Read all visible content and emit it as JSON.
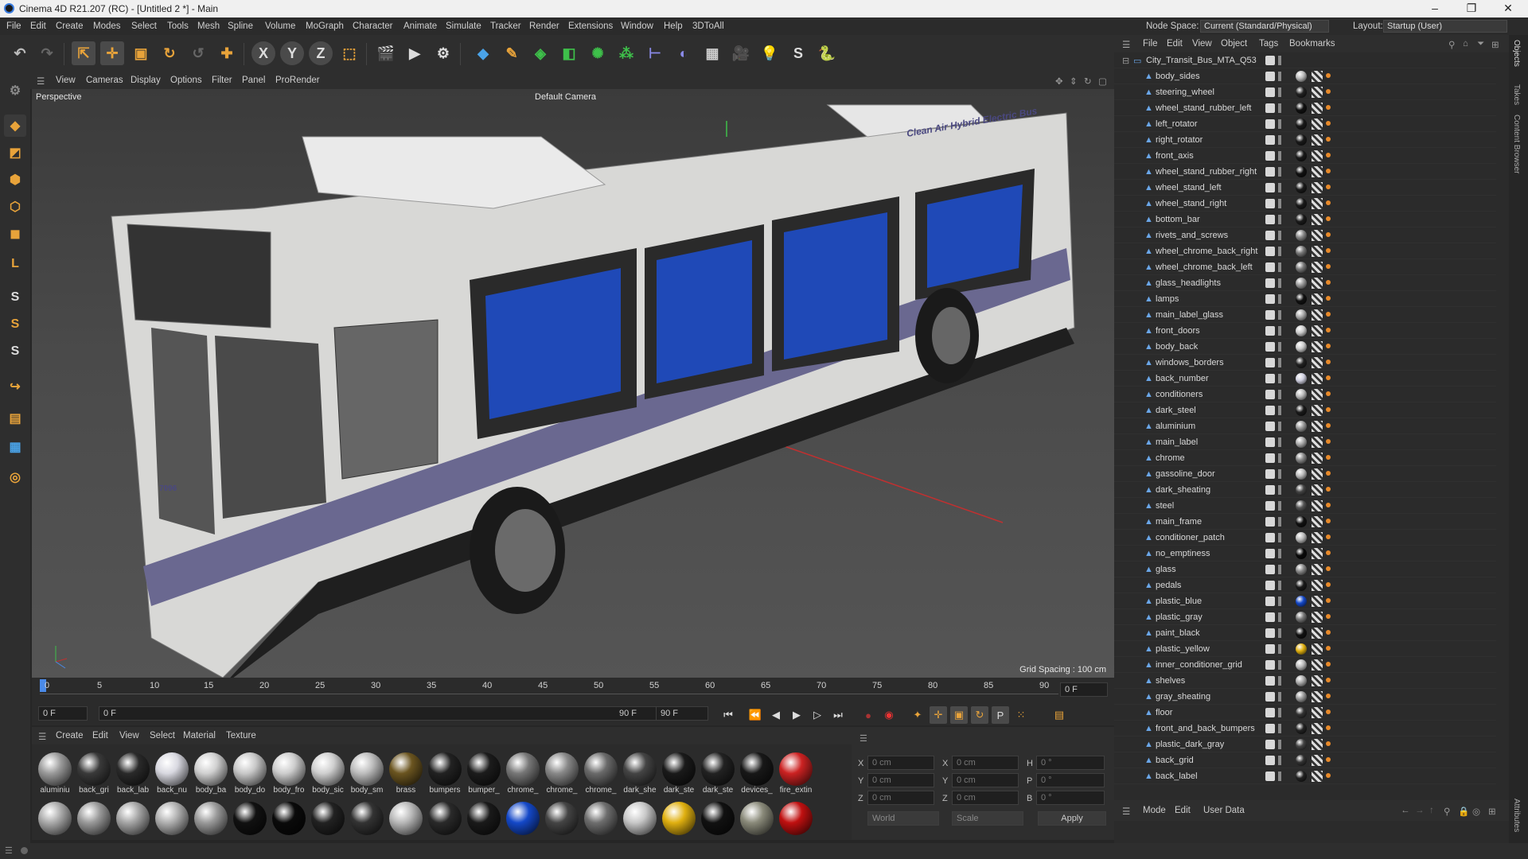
{
  "window": {
    "title": "Cinema 4D R21.207 (RC) - [Untitled 2 *] - Main",
    "controls": [
      "–",
      "❐",
      "✕"
    ]
  },
  "menu": {
    "items": [
      "File",
      "Edit",
      "Create",
      "Modes",
      "Select",
      "Tools",
      "Mesh",
      "Spline",
      "Volume",
      "MoGraph",
      "Character",
      "Animate",
      "Simulate",
      "Tracker",
      "Render",
      "Extensions",
      "Window",
      "Help",
      "3DToAll"
    ],
    "node_space_label": "Node Space:",
    "node_space_value": "Current (Standard/Physical)",
    "layout_label": "Layout:",
    "layout_value": "Startup (User)"
  },
  "toolbar": {
    "icons": [
      "undo-icon",
      "redo-icon",
      "select-icon",
      "move-icon",
      "scale-icon",
      "rotate-icon",
      "recent-tool-icon",
      "coordinate-axis-icon",
      "x-axis-icon",
      "y-axis-icon",
      "z-axis-icon",
      "world-coordinates-icon",
      "render-view-icon",
      "render-picture-viewer-icon",
      "render-settings-icon",
      "cube-icon",
      "pen-icon",
      "subdivision-icon",
      "extrude-icon",
      "cloner-icon",
      "mograph-icon",
      "symmetry-icon",
      "deformer-icon",
      "floor-icon",
      "camera-icon",
      "light-icon",
      "script-icon",
      "python-icon"
    ],
    "axis_labels": [
      "X",
      "Y",
      "Z"
    ]
  },
  "viewport": {
    "menu": [
      "View",
      "Cameras",
      "Display",
      "Options",
      "Filter",
      "Panel",
      "ProRender"
    ],
    "label": "Perspective",
    "camera": "Default Camera",
    "grid_spacing": "Grid Spacing : 100 cm",
    "bus_banner": "Clean Air Hybrid Electric Bus",
    "bus_number": "7096"
  },
  "timeline": {
    "ticks": [
      "0",
      "5",
      "10",
      "15",
      "20",
      "25",
      "30",
      "35",
      "40",
      "45",
      "50",
      "55",
      "60",
      "65",
      "70",
      "75",
      "80",
      "85",
      "90"
    ],
    "current_frame": "0 F"
  },
  "transport": {
    "start": "0 F",
    "range_start": "0 F",
    "range_end": "90 F",
    "end": "90 F"
  },
  "material_manager": {
    "menu": [
      "Create",
      "Edit",
      "View",
      "Select",
      "Material",
      "Texture"
    ],
    "row1": [
      {
        "name": "aluminiu",
        "color": "#9a9a9a"
      },
      {
        "name": "back_gri",
        "color": "#3a3a3a"
      },
      {
        "name": "back_lab",
        "color": "#2a2a2a"
      },
      {
        "name": "back_nu",
        "color": "#d8d8e0"
      },
      {
        "name": "body_ba",
        "color": "#d0d0d0"
      },
      {
        "name": "body_do",
        "color": "#c8c8c8"
      },
      {
        "name": "body_fro",
        "color": "#cdcdcd"
      },
      {
        "name": "body_sic",
        "color": "#cfcfcf"
      },
      {
        "name": "body_sm",
        "color": "#bdbdbd"
      },
      {
        "name": "brass",
        "color": "#6b5520"
      },
      {
        "name": "bumpers",
        "color": "#222"
      },
      {
        "name": "bumper_",
        "color": "#1c1c1c"
      },
      {
        "name": "chrome_",
        "color": "#777"
      },
      {
        "name": "chrome_",
        "color": "#888"
      },
      {
        "name": "chrome_",
        "color": "#6a6a6a"
      },
      {
        "name": "dark_she",
        "color": "#444"
      },
      {
        "name": "dark_ste",
        "color": "#1a1a1a"
      },
      {
        "name": "dark_ste",
        "color": "#222"
      },
      {
        "name": "devices_",
        "color": "#181818"
      },
      {
        "name": "fire_extin",
        "color": "#c22"
      }
    ],
    "row2": [
      "#aaa",
      "#999",
      "#a5a5a5",
      "#b0b0b0",
      "#9a9a9a",
      "#111",
      "#0a0a0a",
      "#222",
      "#333",
      "#b8b8b8",
      "#2a2a2a",
      "#1a1a1a",
      "#1448c8",
      "#444",
      "#6e6e6e",
      "#c8c8c8",
      "#e0b010",
      "#111",
      "#8a8a7a",
      "#c01010"
    ]
  },
  "coordinates": {
    "x_pos": "0 cm",
    "y_pos": "0 cm",
    "z_pos": "0 cm",
    "x_size": "0 cm",
    "y_size": "0 cm",
    "z_size": "0 cm",
    "h": "0 °",
    "p": "0 °",
    "b": "0 °",
    "mode1": "World",
    "mode2": "Scale",
    "apply": "Apply"
  },
  "object_manager": {
    "menu": [
      "File",
      "Edit",
      "View",
      "Object",
      "Tags",
      "Bookmarks"
    ],
    "root": "City_Transit_Bus_MTA_Q53",
    "objects": [
      {
        "name": "body_sides",
        "mat": "#bbb"
      },
      {
        "name": "steering_wheel",
        "mat": "#222"
      },
      {
        "name": "wheel_stand_rubber_left",
        "mat": "#111"
      },
      {
        "name": "left_rotator",
        "mat": "#1a1a1a"
      },
      {
        "name": "right_rotator",
        "mat": "#1a1a1a"
      },
      {
        "name": "front_axis",
        "mat": "#1a1a1a"
      },
      {
        "name": "wheel_stand_rubber_right",
        "mat": "#111"
      },
      {
        "name": "wheel_stand_left",
        "mat": "#1a1a1a"
      },
      {
        "name": "wheel_stand_right",
        "mat": "#1a1a1a"
      },
      {
        "name": "bottom_bar",
        "mat": "#1a1a1a"
      },
      {
        "name": "rivets_and_screws",
        "mat": "#888"
      },
      {
        "name": "wheel_chrome_back_right",
        "mat": "#777"
      },
      {
        "name": "wheel_chrome_back_left",
        "mat": "#777"
      },
      {
        "name": "glass_headlights",
        "mat": "#999"
      },
      {
        "name": "lamps",
        "mat": "#111"
      },
      {
        "name": "main_label_glass",
        "mat": "#aaa"
      },
      {
        "name": "front_doors",
        "mat": "#ccc"
      },
      {
        "name": "body_back",
        "mat": "#ccc"
      },
      {
        "name": "windows_borders",
        "mat": "#222"
      },
      {
        "name": "back_number",
        "mat": "#d0d0e0"
      },
      {
        "name": "conditioners",
        "mat": "#bbb"
      },
      {
        "name": "dark_steel",
        "mat": "#1a1a1a"
      },
      {
        "name": "aluminium",
        "mat": "#999"
      },
      {
        "name": "main_label",
        "mat": "#aaa"
      },
      {
        "name": "chrome",
        "mat": "#888"
      },
      {
        "name": "gassoline_door",
        "mat": "#bbb"
      },
      {
        "name": "dark_sheating",
        "mat": "#444"
      },
      {
        "name": "steel",
        "mat": "#555"
      },
      {
        "name": "main_frame",
        "mat": "#111"
      },
      {
        "name": "conditioner_patch",
        "mat": "#bbb"
      },
      {
        "name": "no_emptiness",
        "mat": "#0a0a0a"
      },
      {
        "name": "glass",
        "mat": "#888"
      },
      {
        "name": "pedals",
        "mat": "#1a1a1a"
      },
      {
        "name": "plastic_blue",
        "mat": "#1448c8"
      },
      {
        "name": "plastic_gray",
        "mat": "#777"
      },
      {
        "name": "paint_black",
        "mat": "#111"
      },
      {
        "name": "plastic_yellow",
        "mat": "#e0b010"
      },
      {
        "name": "inner_conditioner_grid",
        "mat": "#bbb"
      },
      {
        "name": "shelves",
        "mat": "#aaa"
      },
      {
        "name": "gray_sheating",
        "mat": "#999"
      },
      {
        "name": "floor",
        "mat": "#333"
      },
      {
        "name": "front_and_back_bumpers",
        "mat": "#222"
      },
      {
        "name": "plastic_dark_gray",
        "mat": "#444"
      },
      {
        "name": "back_grid",
        "mat": "#333"
      },
      {
        "name": "back_label",
        "mat": "#222"
      }
    ]
  },
  "attributes": {
    "menu": [
      "Mode",
      "Edit",
      "User Data"
    ]
  },
  "side_tabs": [
    "Objects",
    "Takes",
    "Content Browser",
    "Attributes"
  ]
}
